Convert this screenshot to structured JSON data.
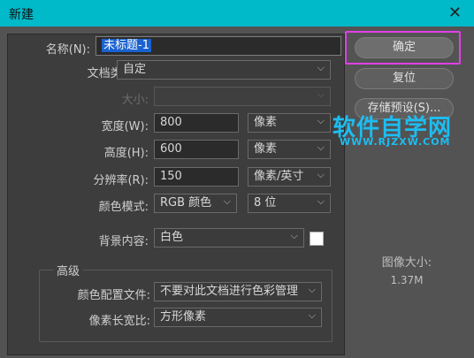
{
  "window": {
    "title": "新建",
    "close_glyph": "✕"
  },
  "form": {
    "name": {
      "label": "名称(N):",
      "value": "未标题-1"
    },
    "doc_type": {
      "label": "文档类型:",
      "value": "自定"
    },
    "size": {
      "label": "大小:",
      "value": ""
    },
    "width": {
      "label": "宽度(W):",
      "value": "800",
      "unit": "像素"
    },
    "height": {
      "label": "高度(H):",
      "value": "600",
      "unit": "像素"
    },
    "resolution": {
      "label": "分辨率(R):",
      "value": "150",
      "unit": "像素/英寸"
    },
    "color_mode": {
      "label": "颜色模式:",
      "value": "RGB 颜色",
      "depth": "8 位"
    },
    "background": {
      "label": "背景内容:",
      "value": "白色",
      "swatch_color": "#ffffff"
    },
    "advanced": {
      "title": "高级",
      "color_profile": {
        "label": "颜色配置文件:",
        "value": "不要对此文档进行色彩管理"
      },
      "pixel_aspect": {
        "label": "像素长宽比:",
        "value": "方形像素"
      }
    }
  },
  "buttons": {
    "ok": "确定",
    "reset": "复位",
    "save_preset": "存储预设(S)..."
  },
  "image_size": {
    "label": "图像大小:",
    "value": "1.37M"
  },
  "watermark": {
    "line1": "软件自学网",
    "line2": "WWW.RJZXW.COM"
  },
  "colors": {
    "titlebar": "#00b9c9",
    "highlight": "#e040e6",
    "selection": "#1a62cf"
  }
}
